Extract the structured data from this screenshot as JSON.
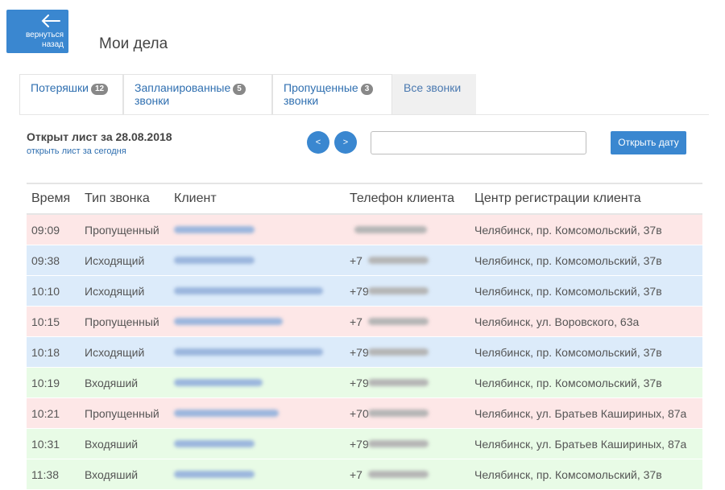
{
  "header": {
    "back_label": "вернуться\nназад",
    "title": "Мои дела"
  },
  "tabs": [
    {
      "label": "Потеряшки",
      "count": "12",
      "active": false
    },
    {
      "label": "Запланированные\nзвонки",
      "count": "5",
      "active": false
    },
    {
      "label": "Пропущенные\nзвонки",
      "count": "3",
      "active": false
    },
    {
      "label": "Все звонки",
      "count": null,
      "active": true
    }
  ],
  "sheet": {
    "open_label": "Открыт лист за 28.08.2018",
    "today_link": "открыть лист за сегодня",
    "prev": "<",
    "next": ">",
    "date_value": "",
    "open_date_button": "Открыть дату"
  },
  "table": {
    "headers": [
      "Время",
      "Тип звонка",
      "Клиент",
      "Телефон клиента",
      "Центр регистрации клиента"
    ],
    "rows": [
      {
        "time": "09:09",
        "type": "Пропущенный",
        "phone_prefix": "",
        "center": "Челябинск, пр. Комсомольский, 37в"
      },
      {
        "time": "09:38",
        "type": "Исходящий",
        "phone_prefix": "+7",
        "center": "Челябинск, пр. Комсомольский, 37в"
      },
      {
        "time": "10:10",
        "type": "Исходящий",
        "phone_prefix": "+79",
        "center": "Челябинск, пр. Комсомольский, 37в"
      },
      {
        "time": "10:15",
        "type": "Пропущенный",
        "phone_prefix": "+7",
        "center": "Челябинск, ул. Воровского, 63а"
      },
      {
        "time": "10:18",
        "type": "Исходящий",
        "phone_prefix": "+79",
        "center": "Челябинск, пр. Комсомольский, 37в"
      },
      {
        "time": "10:19",
        "type": "Входяший",
        "phone_prefix": "+79",
        "center": "Челябинск, пр. Комсомольский, 37в"
      },
      {
        "time": "10:21",
        "type": "Пропущенный",
        "phone_prefix": "+70",
        "center": "Челябинск, ул. Братьев Кашириных, 87а"
      },
      {
        "time": "10:31",
        "type": "Входяший",
        "phone_prefix": "+79",
        "center": "Челябинск, ул. Братьев Кашириных, 87а"
      },
      {
        "time": "11:38",
        "type": "Входяший",
        "phone_prefix": "+7",
        "center": "Челябинск, пр. Комсомольский, 37в"
      }
    ]
  },
  "colors": {
    "accent": "#3a87d0",
    "missed_row": "#fde7e7",
    "outgoing_row": "#dcebfa",
    "incoming_row": "#e8fbe6"
  },
  "icons": {
    "back": "arrow-left-icon"
  }
}
